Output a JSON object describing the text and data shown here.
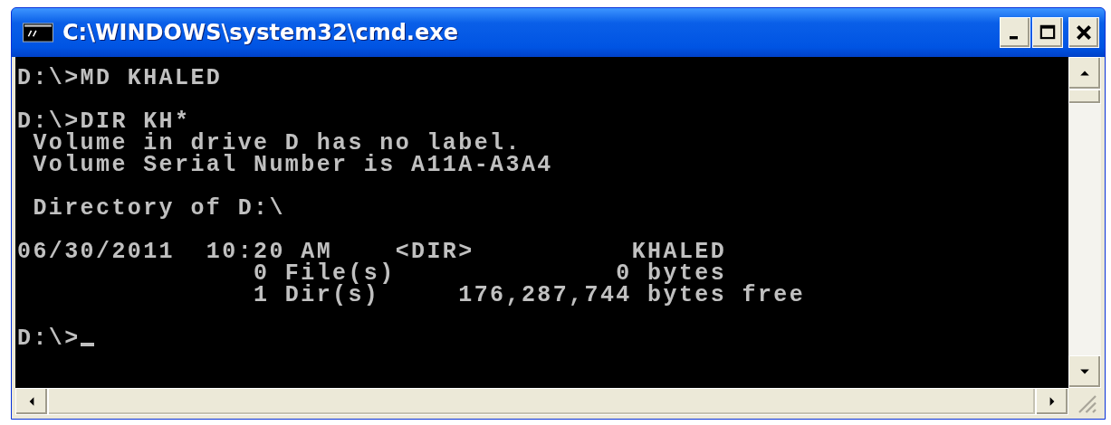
{
  "window": {
    "title": "C:\\WINDOWS\\system32\\cmd.exe"
  },
  "console": {
    "blocks": [
      {
        "lines": [
          "D:\\>MD KHALED"
        ]
      },
      {
        "lines": [
          "D:\\>DIR KH*",
          " Volume in drive D has no label.",
          " Volume Serial Number is A11A-A3A4"
        ]
      },
      {
        "lines": [
          " Directory of D:\\"
        ]
      },
      {
        "lines": [
          "06/30/2011  10:20 AM    <DIR>          KHALED",
          "               0 File(s)              0 bytes",
          "               1 Dir(s)     176,287,744 bytes free"
        ]
      },
      {
        "lines": [
          "D:\\>"
        ],
        "cursor": true
      }
    ]
  }
}
